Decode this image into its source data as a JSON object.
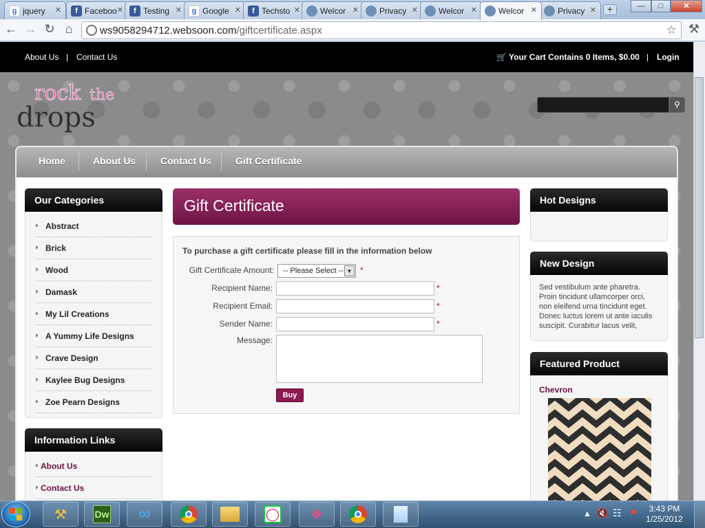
{
  "browser": {
    "tabs": [
      {
        "label": "jquery",
        "icon": "google-icon"
      },
      {
        "label": "Faceboo",
        "icon": "facebook-icon"
      },
      {
        "label": "Testing",
        "icon": "facebook-icon"
      },
      {
        "label": "Google",
        "icon": "google-icon"
      },
      {
        "label": "Techsto",
        "icon": "facebook-icon"
      },
      {
        "label": "Welcor",
        "icon": "globe-icon"
      },
      {
        "label": "Privacy",
        "icon": "globe-icon"
      },
      {
        "label": "Welcor",
        "icon": "globe-icon"
      },
      {
        "label": "Welcor",
        "icon": "globe-icon",
        "active": true
      },
      {
        "label": "Privacy",
        "icon": "globe-icon"
      }
    ],
    "new_tab_label": "+",
    "url_host": "ws9058294712.websoon.com",
    "url_path": "/giftcertificate.aspx"
  },
  "site": {
    "top_links": {
      "about": "About Us",
      "sep": "|",
      "contact": "Contact Us"
    },
    "cart_text": "Your Cart Contains 0 Items, $0.00",
    "cart_sep": "|",
    "login": "Login",
    "logo_rock": "rock",
    "logo_the": "the",
    "logo_drops": "drops",
    "nav": [
      "Home",
      "About Us",
      "Contact Us",
      "Gift Certificate"
    ]
  },
  "categories": {
    "title": "Our Categories",
    "items": [
      "Abstract",
      "Brick",
      "Wood",
      "Damask",
      "My Lil Creations",
      "A Yummy Life Designs",
      "Crave Design",
      "Kaylee Bug Designs",
      "Zoe Pearn Designs"
    ]
  },
  "info_links": {
    "title": "Information Links",
    "items": [
      "About Us",
      "Contact Us"
    ]
  },
  "gift": {
    "title": "Gift Certificate",
    "intro": "To purchase a gift certificate please fill in the information below",
    "amount_label": "Gift Certificate Amount:",
    "amount_value": "-- Please Select --",
    "recipient_name_label": "Recipient Name:",
    "recipient_email_label": "Recipient Email:",
    "sender_name_label": "Sender Name:",
    "message_label": "Message:",
    "required_mark": "*",
    "buy": "Buy"
  },
  "sidebar_right": {
    "hot_designs": "Hot Designs",
    "new_design": "New Design",
    "new_design_text": "Sed vestibulum ante pharetra. Proin tincidunt ullamcorper orci, non eleifend urna tincidunt eget. Donec luctus lorem ut ante iaculis suscipit. Curabitur lacus velit,",
    "featured": "Featured Product",
    "featured_name": "Chevron"
  },
  "taskbar": {
    "time": "3:43 PM",
    "date": "1/25/2012",
    "apps": [
      "tools-icon",
      "dreamweaver-icon",
      "infinity-icon",
      "chrome-icon",
      "explorer-icon",
      "messenger-icon",
      "ribbon-icon",
      "chrome-icon",
      "notepad-icon"
    ],
    "dw_label": "Dw"
  },
  "colors": {
    "brand": "#8b1a50",
    "header": "#7a1b4c",
    "topbar": "#000000"
  }
}
